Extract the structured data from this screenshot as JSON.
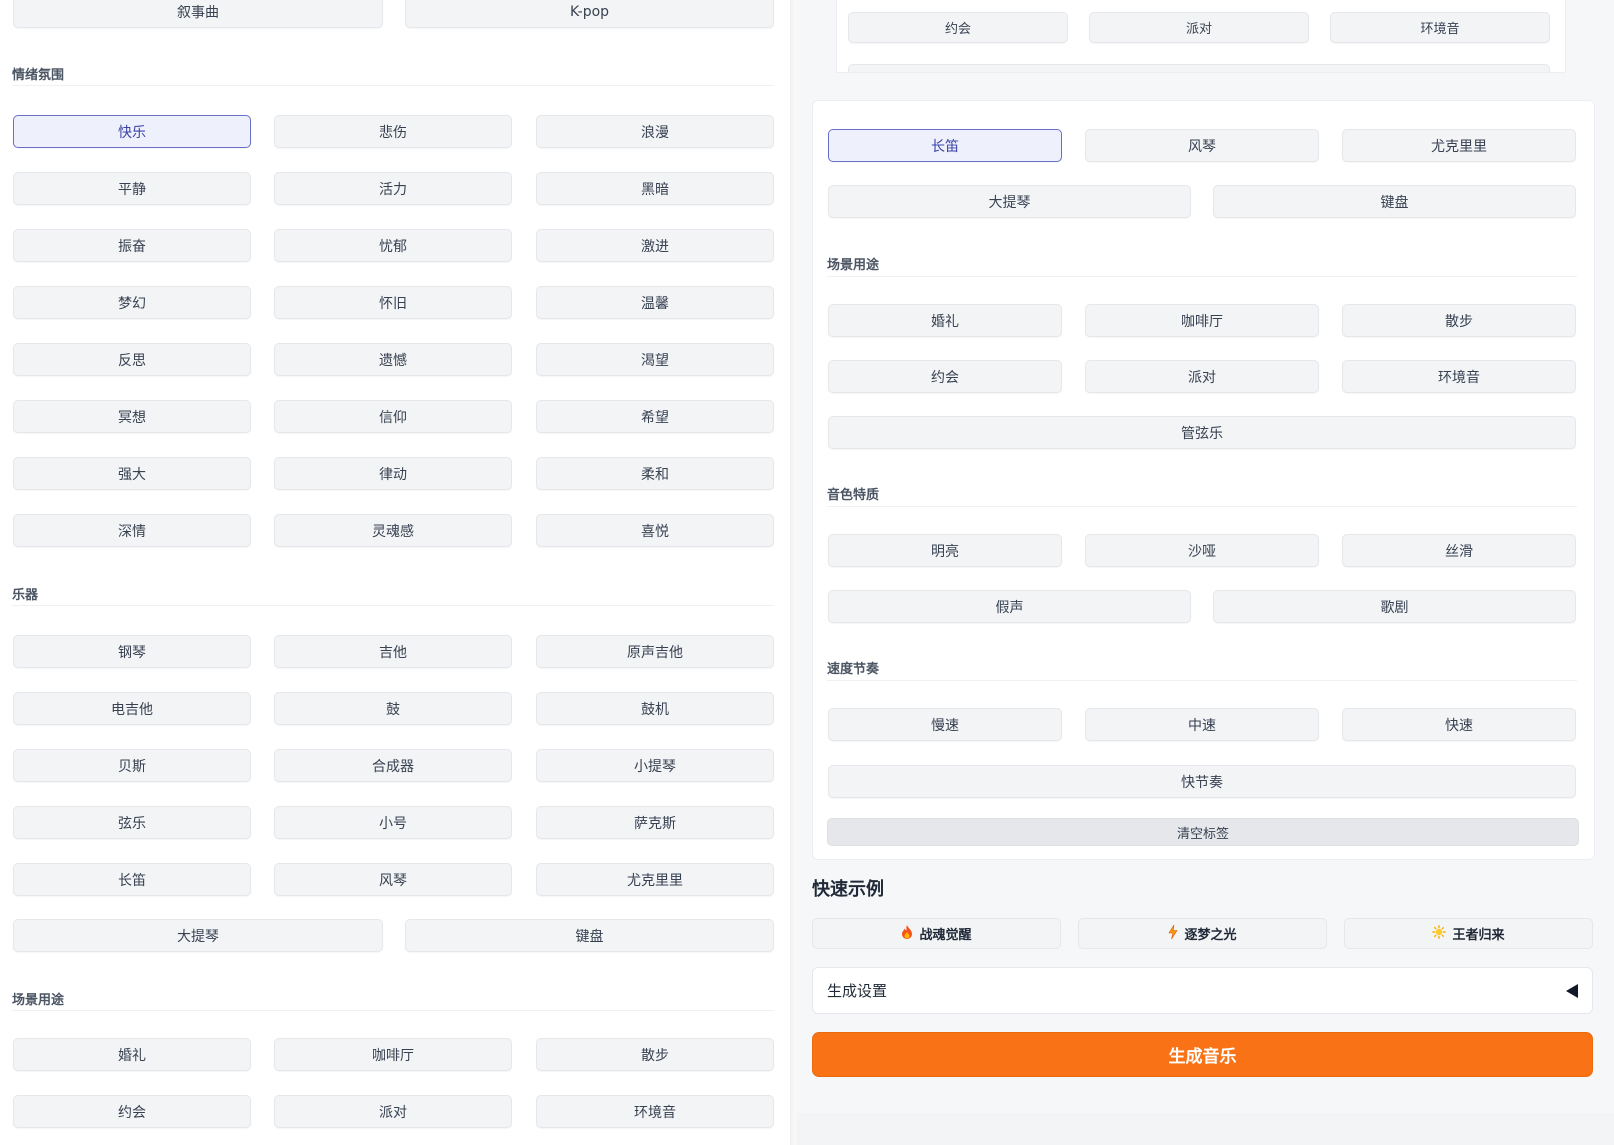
{
  "colors": {
    "accent_selected_border": "#6870c9",
    "generate_button": "#f97316",
    "button_bg": "#f3f4f6"
  },
  "left": {
    "top_row": [
      "叙事曲",
      "K-pop"
    ],
    "mood": {
      "label": "情绪氛围",
      "items": [
        "快乐",
        "悲伤",
        "浪漫",
        "平静",
        "活力",
        "黑暗",
        "振奋",
        "忧郁",
        "激进",
        "梦幻",
        "怀旧",
        "温馨",
        "反思",
        "遗憾",
        "渴望",
        "冥想",
        "信仰",
        "希望",
        "强大",
        "律动",
        "柔和",
        "深情",
        "灵魂感",
        "喜悦"
      ],
      "selected": "快乐"
    },
    "instruments": {
      "label": "乐器",
      "items": [
        "钢琴",
        "吉他",
        "原声吉他",
        "电吉他",
        "鼓",
        "鼓机",
        "贝斯",
        "合成器",
        "小提琴",
        "弦乐",
        "小号",
        "萨克斯",
        "长笛",
        "风琴",
        "尤克里里"
      ],
      "wide_items": [
        "大提琴",
        "键盘"
      ]
    },
    "scene": {
      "label": "场景用途",
      "items": [
        "婚礼",
        "咖啡厅",
        "散步",
        "约会",
        "派对",
        "环境音"
      ]
    }
  },
  "right": {
    "top_row": [
      "约会",
      "派对",
      "环境音"
    ],
    "instruments": {
      "items": [
        "长笛",
        "风琴",
        "尤克里里"
      ],
      "selected": "长笛",
      "wide_items": [
        "大提琴",
        "键盘"
      ]
    },
    "scene": {
      "label": "场景用途",
      "items": [
        "婚礼",
        "咖啡厅",
        "散步",
        "约会",
        "派对",
        "环境音"
      ],
      "full_item": "管弦乐"
    },
    "timbre": {
      "label": "音色特质",
      "items": [
        "明亮",
        "沙哑",
        "丝滑"
      ],
      "wide_items": [
        "假声",
        "歌剧"
      ]
    },
    "tempo": {
      "label": "速度节奏",
      "items": [
        "慢速",
        "中速",
        "快速"
      ],
      "full_item": "快节奏"
    },
    "clear_label": "清空标签",
    "quick_examples": {
      "title": "快速示例",
      "items": [
        {
          "icon": "fire-icon",
          "label": "战魂觉醒"
        },
        {
          "icon": "lightning-icon",
          "label": "逐梦之光"
        },
        {
          "icon": "sun-icon",
          "label": "王者归来"
        }
      ]
    },
    "settings_label": "生成设置",
    "generate_label": "生成音乐"
  }
}
